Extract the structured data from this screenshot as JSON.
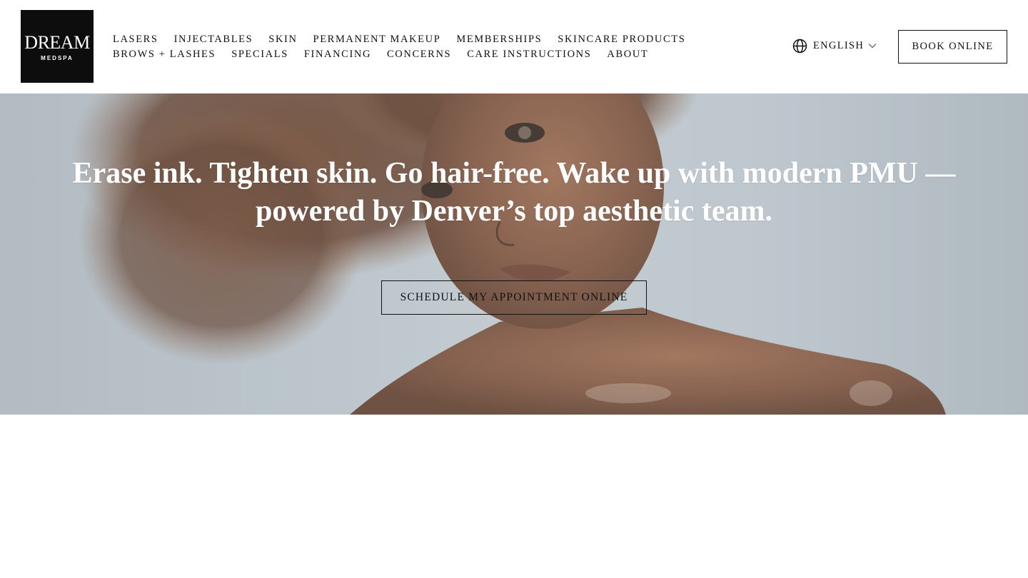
{
  "logo": {
    "main": "DREAM",
    "sub": "MEDSPA"
  },
  "nav": {
    "row1": [
      "LASERS",
      "INJECTABLES",
      "SKIN",
      "PERMANENT MAKEUP",
      "MEMBERSHIPS",
      "SKINCARE PRODUCTS"
    ],
    "row2": [
      "BROWS + LASHES",
      "SPECIALS",
      "FINANCING",
      "CONCERNS",
      "CARE INSTRUCTIONS",
      "ABOUT"
    ]
  },
  "language": {
    "label": "ENGLISH",
    "icon": "globe-icon"
  },
  "book_button": "BOOK ONLINE",
  "hero": {
    "heading": "Erase ink. Tighten skin. Go hair-free. Wake up with modern PMU — powered by Denver’s top aesthetic team.",
    "cta": "SCHEDULE MY APPOINTMENT ONLINE"
  },
  "colors": {
    "logo_bg": "#0d0d0d",
    "hero_bg": "#bcc5cb",
    "text": "#111111",
    "hero_text": "#ffffff",
    "skin": "#7a4b33",
    "hair": "#5a3420"
  }
}
